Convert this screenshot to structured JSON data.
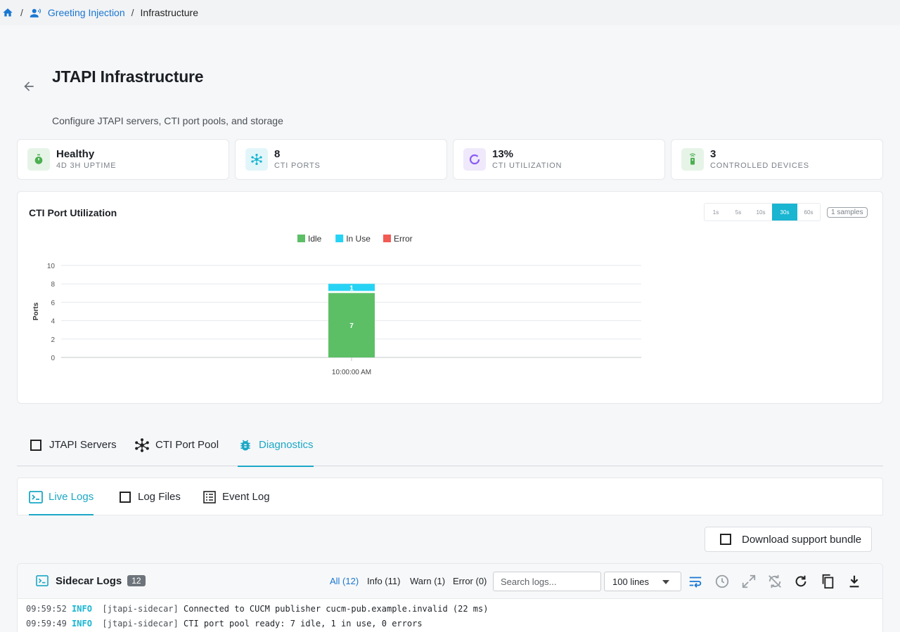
{
  "breadcrumb": {
    "home_icon": "home-icon",
    "greeting_icon": "users-voice-icon",
    "greeting_label": "Greeting Injection",
    "current_label": "Infrastructure",
    "separator": "/"
  },
  "header": {
    "title": "JTAPI Infrastructure",
    "subtitle": "Configure JTAPI servers, CTI port pools, and storage"
  },
  "stats": [
    {
      "value": "Healthy",
      "label": "4D 3H UPTIME",
      "icon": "stopwatch-icon",
      "color": "#4caf50",
      "bg": "#e6f4e8"
    },
    {
      "value": "8",
      "label": "CTI PORTS",
      "icon": "hub-icon",
      "color": "#19b5d1",
      "bg": "#e2f6fa"
    },
    {
      "value": "13%",
      "label": "CTI UTILIZATION",
      "icon": "donut-icon",
      "color": "#8b5cf6",
      "bg": "#efe9fb"
    },
    {
      "value": "3",
      "label": "CONTROLLED DEVICES",
      "icon": "remote-icon",
      "color": "#4caf50",
      "bg": "#e6f4e8"
    }
  ],
  "chart_panel": {
    "title": "CTI Port Utilization",
    "ranges": [
      "1s",
      "5s",
      "10s",
      "30s",
      "60s"
    ],
    "active_range": "30s",
    "samples": "1 samples"
  },
  "chart_data": {
    "type": "bar",
    "stacked": true,
    "categories": [
      "10:00:00 AM"
    ],
    "series": [
      {
        "name": "Idle",
        "values": [
          7
        ],
        "color": "#5cbf66"
      },
      {
        "name": "In Use",
        "values": [
          1
        ],
        "color": "#27d3f4"
      },
      {
        "name": "Error",
        "values": [
          0
        ],
        "color": "#f25a54"
      }
    ],
    "ylabel": "Ports",
    "xlabel": "",
    "ylim": [
      0,
      10
    ],
    "yticks": [
      0,
      2,
      4,
      6,
      8,
      10
    ],
    "grid": true,
    "legend": "top-center"
  },
  "tabs": [
    {
      "label": "JTAPI Servers",
      "icon": "square-icon",
      "active": false
    },
    {
      "label": "CTI Port Pool",
      "icon": "hub-icon",
      "active": false
    },
    {
      "label": "Diagnostics",
      "icon": "bug-icon",
      "active": true
    }
  ],
  "subtabs": [
    {
      "label": "Live Logs",
      "icon": "terminal-icon",
      "active": true
    },
    {
      "label": "Log Files",
      "icon": "square-icon",
      "active": false
    },
    {
      "label": "Event Log",
      "icon": "list-icon",
      "active": false
    }
  ],
  "bundle_button": {
    "label": "Download support bundle",
    "icon": "square-icon"
  },
  "logs": {
    "title": "Sidecar Logs",
    "count": "12",
    "filters": [
      "All (12)",
      "Info (11)",
      "Warn (1)",
      "Error (0)"
    ],
    "active_filter": "All (12)",
    "search_placeholder": "Search logs...",
    "lines_option": "100 lines",
    "tools": [
      "wrap-icon",
      "clock-icon",
      "expand-icon",
      "sync-off-icon",
      "refresh-icon",
      "copy-icon",
      "download-icon"
    ],
    "entries": [
      {
        "time": "09:59:52",
        "level": "INFO",
        "source": "[jtapi-sidecar]",
        "message": "Connected to CUCM publisher cucm-pub.example.invalid (22 ms)"
      },
      {
        "time": "09:59:49",
        "level": "INFO",
        "source": "[jtapi-sidecar]",
        "message": "CTI port pool ready: 7 idle, 1 in use, 0 errors"
      }
    ]
  }
}
